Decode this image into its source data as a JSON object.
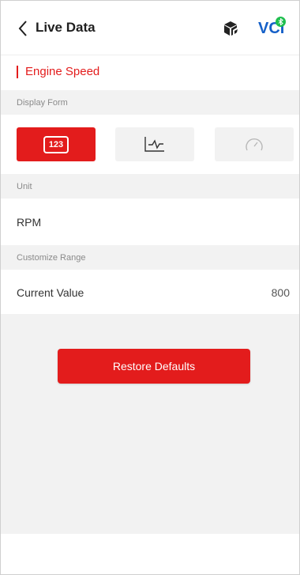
{
  "header": {
    "title": "Live Data",
    "vci_label": "VCI"
  },
  "section": {
    "title": "Engine Speed"
  },
  "display_form": {
    "label": "Display Form",
    "options": [
      {
        "name": "numeric",
        "label": "123",
        "selected": true
      },
      {
        "name": "graph",
        "selected": false
      },
      {
        "name": "gauge",
        "selected": false
      }
    ]
  },
  "unit": {
    "label": "Unit",
    "value": "RPM"
  },
  "custom_range": {
    "label": "Customize Range"
  },
  "current_value": {
    "label": "Current Value",
    "value": "800"
  },
  "actions": {
    "restore_label": "Restore Defaults"
  },
  "colors": {
    "accent": "#e31c1c",
    "vci_blue": "#1560c8",
    "bluetooth_green": "#1fbf4f"
  }
}
